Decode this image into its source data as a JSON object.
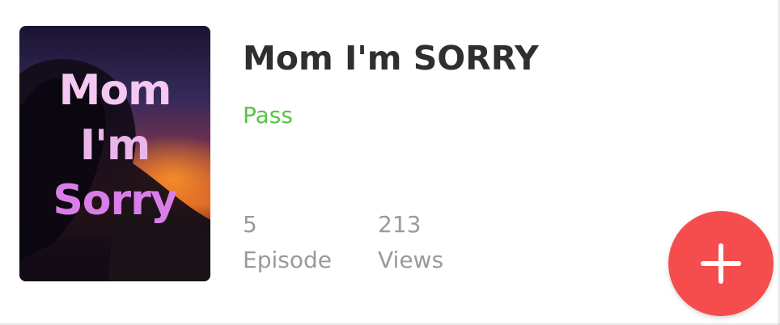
{
  "cover": {
    "title_lines": [
      "Mom",
      "I'm",
      "Sorry"
    ]
  },
  "book": {
    "title": "Mom I'm SORRY",
    "status": "Pass"
  },
  "stats": {
    "episodes": {
      "value": "5",
      "label": "Episode"
    },
    "views": {
      "value": "213",
      "label": "Views"
    }
  },
  "actions": {
    "add_icon": "plus-icon"
  },
  "colors": {
    "status": "#57c443",
    "fab": "#f54d4d",
    "title": "#2f2f2f",
    "muted": "#9a9a9a"
  }
}
